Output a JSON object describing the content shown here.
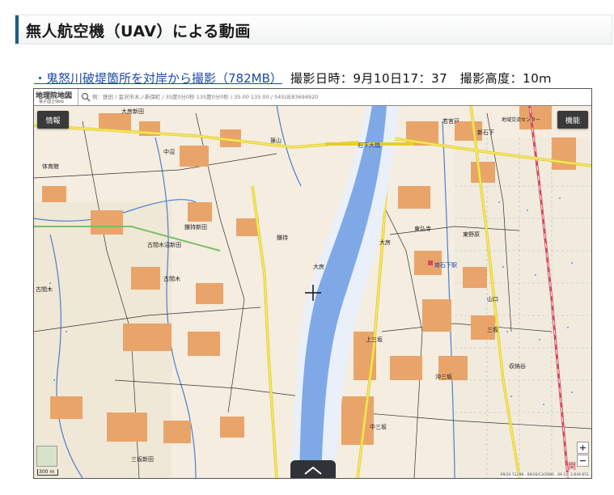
{
  "section": {
    "title": "無人航空機（UAV）による動画"
  },
  "video": {
    "link_label": "・鬼怒川破堤箇所を対岸から撮影（782MB）",
    "meta": "撮影日時：9月10日17：37　撮影高度：10ｍ"
  },
  "map": {
    "brand": "地理院地図",
    "brand_sub": "電子国土Web",
    "search_placeholder": "例：鉄田 / 金沢市木ノ新保町 / 35度0分0秒 135度0分0秒 / 35.00 135.00 / 54SUE83694920",
    "buttons": {
      "info": "情報",
      "func": "機能"
    },
    "zoom_in": "+",
    "zoom_out": "−",
    "scale_label": "300 m",
    "coords": "09/20 51289.. 09/20/13/2680.. 09 2ニ 2,649.651",
    "places": [
      "大房新田",
      "中沼",
      "体育館",
      "篠山",
      "石下大橋",
      "若宮戸",
      "新石下",
      "地域交流センター",
      "鎌持新田",
      "古間木沼新田",
      "鎌持",
      "古間木",
      "東弘寺",
      "東野原",
      "大房",
      "南石下駅",
      "山口",
      "古間木",
      "上三坂",
      "沖三坂",
      "三坂新田",
      "中三坂",
      "大房",
      "収納谷",
      "三坂",
      "関"
    ],
    "colors": {
      "river": "#7fa9e6",
      "paper": "#f4ede0",
      "road_major": "#f2e45a",
      "rail": "#d44b5a"
    },
    "icons": [
      "search-icon",
      "crosshair-icon",
      "chevron-up-icon"
    ]
  }
}
